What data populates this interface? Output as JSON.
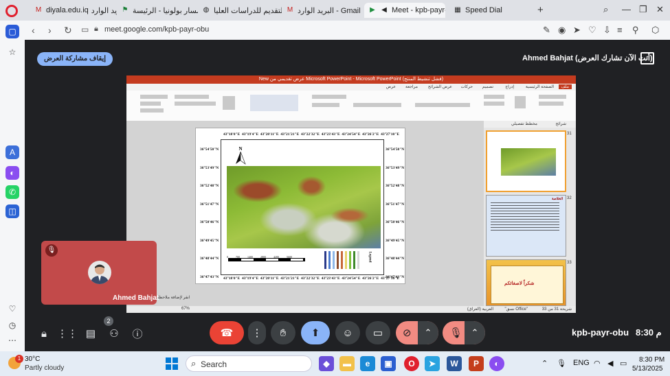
{
  "browser": {
    "tabs": [
      {
        "title": "diyala.edu.iq",
        "icon": "gmail-icon"
      },
      {
        "title": "البريد الوارد",
        "icon": "gmail-icon"
      },
      {
        "title": "نظام مسار بولونيا - الرئيسة",
        "icon": "flag-icon"
      },
      {
        "title": "نظام التقديم للدراسات العليا",
        "icon": "globe-icon"
      },
      {
        "title": "البريد الوارد - Gmail - .com",
        "icon": "gmail-icon"
      },
      {
        "title": "Meet - kpb-payr-obu",
        "icon": "meet-icon"
      },
      {
        "title": "Speed Dial",
        "icon": "grid-icon"
      }
    ],
    "url": "meet.google.com/kpb-payr-obu"
  },
  "meet": {
    "stop_sharing_label": "إيقاف مشاركة العرض",
    "presenting_label": "Ahmed Bahjat (أنت الآن تشارك العرض)",
    "self_name": "Ahmed Bahjat",
    "people_count": "2",
    "meeting_code": "kpb-payr-obu",
    "time": "8:30 م"
  },
  "shared_screen": {
    "ppt_title": "New عرض تقديمي من Microsoft PowerPoint - Microsoft PowerPoint (فشل تنشيط المنتج)",
    "ribbon_tabs": [
      "ملف",
      "الصفحة الرئيسية",
      "إدراج",
      "تصميم",
      "حركات",
      "عرض الشرائح",
      "مراجعة",
      "عرض"
    ],
    "thumbs_header": [
      "شرائح",
      "مخطط تفصيلي"
    ],
    "thumb_numbers": [
      "31",
      "32",
      "33"
    ],
    "thumb_32_title": "الخلاصة",
    "thumb_33_text": "شكراً لاصغائكم",
    "status_left": "شريحة 31 من 33",
    "status_theme": "\"نسق Office\"",
    "status_lang": "العربية (العراق)",
    "zoom": "67%",
    "notes_placeholder": "انقر لإضافة ملاحظات",
    "slide": {
      "top_coords": [
        "43°18'0\"E",
        "43°19'4\"E",
        "43°20'11\"E",
        "43°21'21\"E",
        "43°22'32\"E",
        "43°23'43\"E",
        "43°24'54\"E",
        "43°26'2\"E",
        "43°27'10\"E"
      ],
      "left_coords": [
        "36°54'50\"N",
        "36°53'49\"N",
        "36°52'48\"N",
        "36°51'47\"N",
        "36°50'46\"N",
        "36°49'45\"N",
        "36°48'44\"N",
        "36°47'43\"N"
      ],
      "right_coords": [
        "36°54'50\"N",
        "36°53'49\"N",
        "36°52'48\"N",
        "36°51'47\"N",
        "36°50'46\"N",
        "36°49'45\"N",
        "36°48'44\"N",
        "36°47'43\"N"
      ],
      "north_label": "N",
      "scale_labels": [
        "0",
        "700",
        "1400",
        "2800",
        "4200",
        "5600"
      ],
      "legend_title": "Legend",
      "legend_colors": [
        "#2a3a8a",
        "#4a7bd0",
        "#8fb8e8",
        "#8a4a2a",
        "#c86a3a",
        "#e8d36a",
        "#7fc23a",
        "#3f8a2a",
        "#d8d8d8"
      ]
    }
  },
  "taskbar": {
    "weather_temp": "30°C",
    "weather_desc": "Partly cloudy",
    "weather_badge": "1",
    "search_label": "Search",
    "language": "ENG",
    "clock_time": "8:30 PM",
    "clock_date": "5/13/2025"
  },
  "colors": {
    "meet_bg": "#202124",
    "accent_blue": "#8ab4f8",
    "end_call_red": "#ea4335",
    "off_red": "#f28b82",
    "self_tile": "#c24a4a"
  }
}
